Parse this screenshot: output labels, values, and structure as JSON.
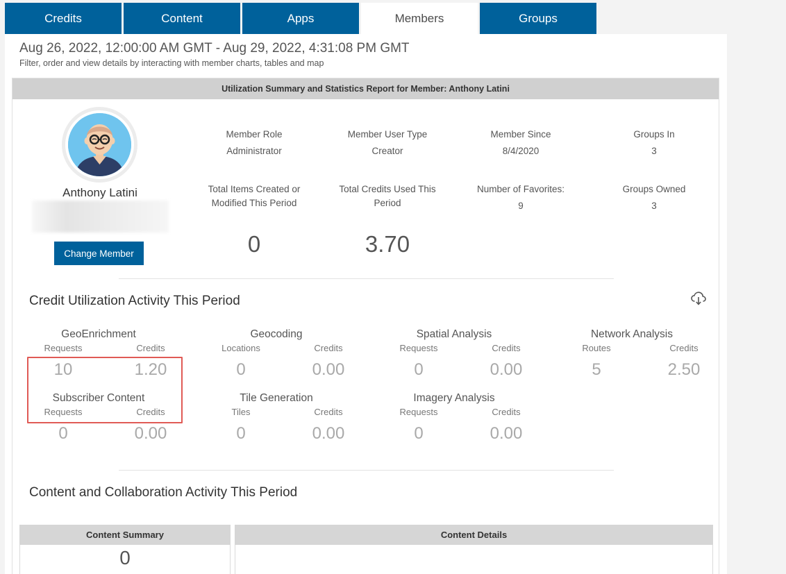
{
  "tabs": [
    {
      "label": "Credits",
      "active": false
    },
    {
      "label": "Content",
      "active": false
    },
    {
      "label": "Apps",
      "active": false
    },
    {
      "label": "Members",
      "active": true
    },
    {
      "label": "Groups",
      "active": false
    }
  ],
  "header": {
    "date_range": "Aug 26, 2022, 12:00:00 AM GMT - Aug 29, 2022, 4:31:08 PM GMT",
    "caption": "Filter, order and view details by interacting with member charts, tables and map"
  },
  "report": {
    "title": "Utilization Summary and Statistics Report for Member: Anthony Latini",
    "member_name": "Anthony Latini",
    "change_member_label": "Change Member",
    "stats": {
      "role_label": "Member Role",
      "role_value": "Administrator",
      "user_type_label": "Member User Type",
      "user_type_value": "Creator",
      "since_label": "Member Since",
      "since_value": "8/4/2020",
      "groups_in_label": "Groups In",
      "groups_in_value": "3",
      "items_label": "Total Items Created or Modified This Period",
      "items_value": "0",
      "credits_label": "Total Credits Used This Period",
      "credits_value": "3.70",
      "favorites_label": "Number of Favorites:",
      "favorites_value": "9",
      "groups_owned_label": "Groups Owned",
      "groups_owned_value": "3"
    }
  },
  "credit_section": {
    "title": "Credit Utilization Activity This Period",
    "metrics": [
      {
        "name": "GeoEnrichment",
        "left_label": "Requests",
        "left_value": "10",
        "right_label": "Credits",
        "right_value": "1.20"
      },
      {
        "name": "Geocoding",
        "left_label": "Locations",
        "left_value": "0",
        "right_label": "Credits",
        "right_value": "0.00"
      },
      {
        "name": "Spatial Analysis",
        "left_label": "Requests",
        "left_value": "0",
        "right_label": "Credits",
        "right_value": "0.00"
      },
      {
        "name": "Network Analysis",
        "left_label": "Routes",
        "left_value": "5",
        "right_label": "Credits",
        "right_value": "2.50"
      },
      {
        "name": "Subscriber Content",
        "left_label": "Requests",
        "left_value": "0",
        "right_label": "Credits",
        "right_value": "0.00"
      },
      {
        "name": "Tile Generation",
        "left_label": "Tiles",
        "left_value": "0",
        "right_label": "Credits",
        "right_value": "0.00"
      },
      {
        "name": "Imagery Analysis",
        "left_label": "Requests",
        "left_value": "0",
        "right_label": "Credits",
        "right_value": "0.00"
      }
    ]
  },
  "content_section": {
    "title": "Content and Collaboration Activity This Period",
    "summary_header": "Content Summary",
    "summary_value": "0",
    "details_header": "Content Details"
  },
  "icons": {
    "download": "cloud-download-icon",
    "avatar": "avatar-icon"
  },
  "colors": {
    "accent": "#00619b",
    "highlight": "#e05a55"
  }
}
